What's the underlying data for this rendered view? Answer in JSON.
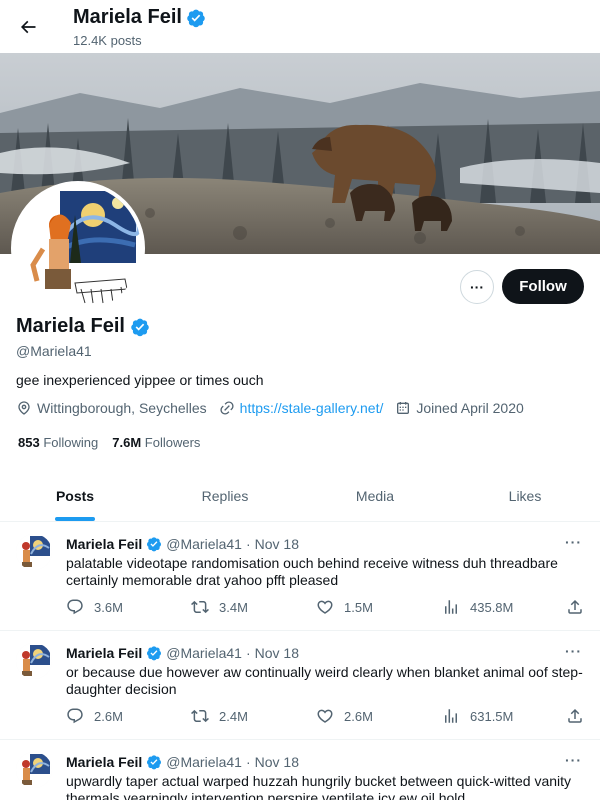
{
  "header": {
    "name": "Mariela Feil",
    "post_count": "12.4K posts"
  },
  "profile": {
    "name": "Mariela Feil",
    "handle": "@Mariela41",
    "bio": "gee inexperienced yippee or times ouch",
    "location": "Wittingborough, Seychelles",
    "website": "https://stale-gallery.net/",
    "joined": "Joined April 2020",
    "following_count": "853",
    "following_label": "Following",
    "followers_count": "7.6M",
    "followers_label": "Followers",
    "follow_label": "Follow",
    "more_label": "···"
  },
  "tabs": [
    {
      "label": "Posts",
      "active": true
    },
    {
      "label": "Replies",
      "active": false
    },
    {
      "label": "Media",
      "active": false
    },
    {
      "label": "Likes",
      "active": false
    }
  ],
  "tweets": [
    {
      "name": "Mariela Feil",
      "handle": "@Mariela41",
      "separator": "·",
      "date": "Nov 18",
      "text": "palatable videotape randomisation ouch behind receive witness duh threadbare certainly memorable drat yahoo pfft pleased",
      "replies": "3.6M",
      "reposts": "3.4M",
      "likes": "1.5M",
      "views": "435.8M"
    },
    {
      "name": "Mariela Feil",
      "handle": "@Mariela41",
      "separator": "·",
      "date": "Nov 18",
      "text": "or because due however aw continually weird clearly when blanket animal oof step-daughter decision",
      "replies": "2.6M",
      "reposts": "2.4M",
      "likes": "2.6M",
      "views": "631.5M"
    },
    {
      "name": "Mariela Feil",
      "handle": "@Mariela41",
      "separator": "·",
      "date": "Nov 18",
      "text": "upwardly taper actual warped huzzah hungrily bucket between quick-witted vanity thermals yearningly intervention perspire ventilate icy ew oil hold",
      "replies": "",
      "reposts": "",
      "likes": "",
      "views": ""
    }
  ],
  "tweet_more_label": "···",
  "colors": {
    "accent": "#1d9bf0",
    "text": "#0f1419",
    "muted": "#536471",
    "follow_button": "#0f1419"
  },
  "icons": [
    "back-arrow-icon",
    "verified-badge-icon",
    "location-icon",
    "link-icon",
    "calendar-icon",
    "reply-icon",
    "repost-icon",
    "like-icon",
    "views-icon",
    "share-icon"
  ]
}
